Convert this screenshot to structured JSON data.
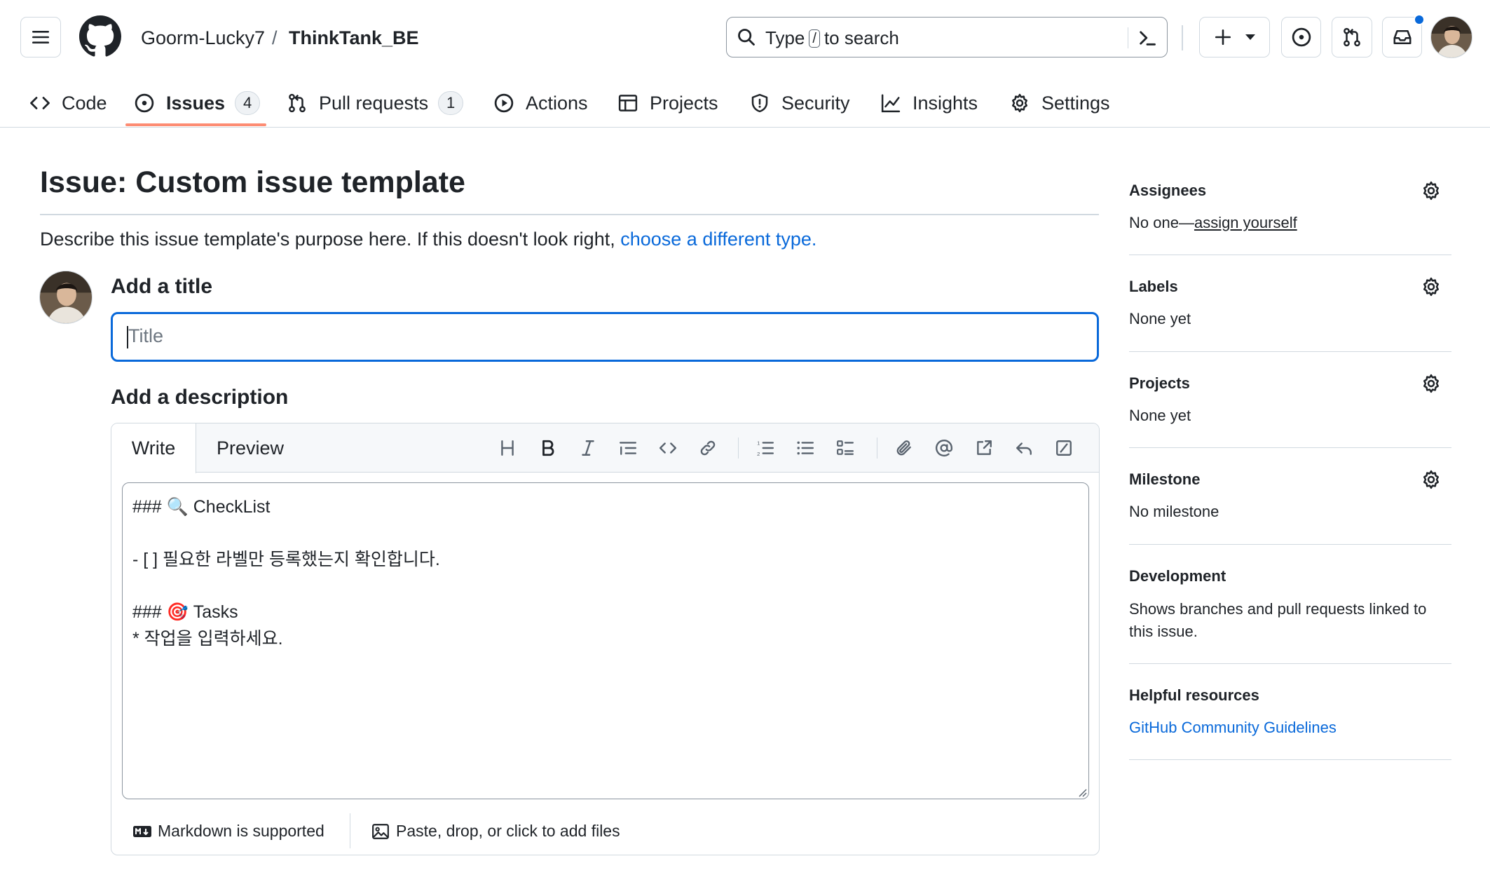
{
  "header": {
    "owner": "Goorm-Lucky7",
    "separator": "/",
    "repo": "ThinkTank_BE",
    "search": {
      "prefix": "Type",
      "key": "/",
      "suffix": "to search"
    }
  },
  "nav_tabs": [
    {
      "label": "Code",
      "icon": "code-icon"
    },
    {
      "label": "Issues",
      "count": "4",
      "icon": "issue-opened-icon",
      "active": true
    },
    {
      "label": "Pull requests",
      "count": "1",
      "icon": "git-pull-request-icon"
    },
    {
      "label": "Actions",
      "icon": "play-icon"
    },
    {
      "label": "Projects",
      "icon": "table-icon"
    },
    {
      "label": "Security",
      "icon": "shield-icon"
    },
    {
      "label": "Insights",
      "icon": "graph-icon"
    },
    {
      "label": "Settings",
      "icon": "gear-icon"
    }
  ],
  "main": {
    "page_title": "Issue: Custom issue template",
    "describe_text": "Describe this issue template's purpose here. If this doesn't look right,",
    "describe_link": "choose a different type.",
    "title_label": "Add a title",
    "title_placeholder": "Title",
    "description_label": "Add a description",
    "editor": {
      "write_tab": "Write",
      "preview_tab": "Preview",
      "body": "### 🔍 CheckList\n\n- [ ] 필요한 라벨만 등록했는지 확인합니다.\n\n### 🎯 Tasks\n* 작업을 입력하세요.",
      "markdown_note": "Markdown is supported",
      "attach_note": "Paste, drop, or click to add files"
    }
  },
  "sidebar": {
    "assignees": {
      "heading": "Assignees",
      "value_prefix": "No one—",
      "value_link": "assign yourself"
    },
    "labels": {
      "heading": "Labels",
      "value": "None yet"
    },
    "projects": {
      "heading": "Projects",
      "value": "None yet"
    },
    "milestone": {
      "heading": "Milestone",
      "value": "No milestone"
    },
    "development": {
      "heading": "Development",
      "value": "Shows branches and pull requests linked to this issue."
    },
    "helpful": {
      "heading": "Helpful resources",
      "link": "GitHub Community Guidelines"
    }
  },
  "colors": {
    "accent": "#0969da",
    "tab_underline": "#fd8c73",
    "notification_dot": "#0969da"
  }
}
